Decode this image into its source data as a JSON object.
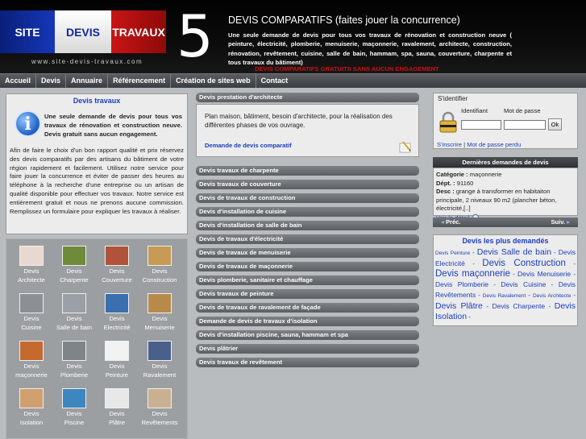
{
  "header": {
    "flag": [
      "SITE",
      "DEVIS",
      "TRAVAUX"
    ],
    "url": "www.site-devis-travaux.com",
    "big_number": "5",
    "title": "DEVIS COMPARATIFS (faites jouer la concurrence)",
    "description": "Une seule demande de devis pour tous vos travaux de rénovation et construction neuve ( peinture, électricité, plomberie, menuiserie, maçonnerie, ravalement, architecte, construction, rénovation, revêtement, cuisine, salle de bain, hammam, spa, sauna, couverture, charpente et tous travaux du bâtiment)",
    "banner": "DEVIS COMPARATIFS GRATUITS SANS AUCUN ENGAGEMENT"
  },
  "menu": [
    "Accueil",
    "Devis",
    "Annuaire",
    "Référencement",
    "Création de sites web",
    "Contact"
  ],
  "left": {
    "title": "Devis travaux",
    "intro": "Une seule demande de devis pour tous vos travaux de rénovation et construction neuve. Devis gratuit sans aucun engagement.",
    "body": "Afin de faire le choix d'un bon rapport qualité et prix réservez des devis comparatifs par des artisans du bâtiment de votre région rapidement et facilement. Utilisez notre service pour faire jouer la concurrence et éviter de passer des heures au téléphone à la recherche d'une entreprise ou un artisan de qualité disponible pour effectuer vos travaux. Notre service est entièrement gratuit et nous ne prenons aucune commission. Remplissez un formulaire pour expliquer les travaux à réaliser."
  },
  "thumbs": [
    {
      "l1": "Devis",
      "l2": "Architecte",
      "color": "#e8d8d0"
    },
    {
      "l1": "Devis",
      "l2": "Charpente",
      "color": "#6f8b3a"
    },
    {
      "l1": "Devis",
      "l2": "Couverture",
      "color": "#b0533a"
    },
    {
      "l1": "Devis",
      "l2": "Construction",
      "color": "#c79a55"
    },
    {
      "l1": "Devis",
      "l2": "Cuisine",
      "color": "#8c8f93"
    },
    {
      "l1": "Devis",
      "l2": "Salle de bain",
      "color": "#9aa0a6"
    },
    {
      "l1": "Devis",
      "l2": "Electricité",
      "color": "#3a6fb0"
    },
    {
      "l1": "Devis",
      "l2": "Menuiserie",
      "color": "#b88a4a"
    },
    {
      "l1": "Devis",
      "l2": "maçonnerie",
      "color": "#c46a2e"
    },
    {
      "l1": "Devis",
      "l2": "Plomberie",
      "color": "#7f8489"
    },
    {
      "l1": "Devis",
      "l2": "Peinture",
      "color": "#f2f2f2"
    },
    {
      "l1": "Devis",
      "l2": "Ravalement",
      "color": "#4a5f8a"
    },
    {
      "l1": "Devis",
      "l2": "Isolation",
      "color": "#d0a070"
    },
    {
      "l1": "Devis",
      "l2": "Piscine",
      "color": "#3d86c0"
    },
    {
      "l1": "Devis",
      "l2": "Plâtre",
      "color": "#e8e8e8"
    },
    {
      "l1": "Devis",
      "l2": "Revêtements",
      "color": "#c8b090"
    }
  ],
  "center": {
    "first_bar": "Devis prestation d'architecte",
    "archi_text": "Plan maison, bâtiment, besoin d'architecte, pour la réalisation des différentes phases de vos ouvrage.",
    "archi_link": "Demande de devis comparatif",
    "bars": [
      "Devis travaux de charpente",
      "Devis travaux de couverture",
      "Devis de travaux de construction",
      "Devis d'installation de cuisine",
      "Devis d'installation de salle de bain",
      "Devis de travaux d'électricité",
      "Devis de travaux de menuiserie",
      "Devis de travaux de maçonnerie",
      "Devis plomberie, sanitaire et chauffage",
      "Devis travaux de peinture",
      "Devis de travaux de ravalement de façade",
      "Demande de devis de travaux d'isolation",
      "Devis d'installation piscine, sauna, hammam et spa",
      "Devis plâtrier",
      "Devis travaux de revêtement"
    ]
  },
  "login": {
    "title": "S'identifier",
    "id_label": "Identifiant",
    "pw_label": "Mot de passe",
    "ok": "Ok",
    "register": "S'inscrire",
    "lost": "Mot de passe perdu"
  },
  "demandes": {
    "title": "Dernières demandes de devis",
    "cat_label": "Catégorie :",
    "cat_value": " maçonnerie",
    "dept_label": "Dépt. :",
    "dept_value": " 91160",
    "desc_label": "Desc :",
    "desc_value": " grange à transformer en habitaiton principale, 2 niveaux 90 m2 (plancher béton, électricité,[..]",
    "link": "Voir le détail",
    "prev": "Préc.",
    "next": "Suiv."
  },
  "tags": {
    "title": "Devis les plus demandés",
    "items": [
      {
        "text": "Devis Peinture",
        "size": "s"
      },
      {
        "text": "Devis Salle de bain",
        "size": "l"
      },
      {
        "text": "Devis Electricité",
        "size": "m"
      },
      {
        "text": "Devis Construction",
        "size": "xl"
      },
      {
        "text": "Devis maçonnerie",
        "size": "xl"
      },
      {
        "text": "Devis Menuiserie",
        "size": "m"
      },
      {
        "text": "Devis Plomberie",
        "size": "m"
      },
      {
        "text": "Devis Cuisine",
        "size": "m"
      },
      {
        "text": "Devis Revêtements",
        "size": "m"
      },
      {
        "text": "Devis Ravalement",
        "size": "s"
      },
      {
        "text": "Devis Architecte",
        "size": "s"
      },
      {
        "text": "Devis Plâtre",
        "size": "l"
      },
      {
        "text": "Devis Charpente",
        "size": "m"
      },
      {
        "text": "Devis Isolation",
        "size": "l"
      }
    ]
  }
}
